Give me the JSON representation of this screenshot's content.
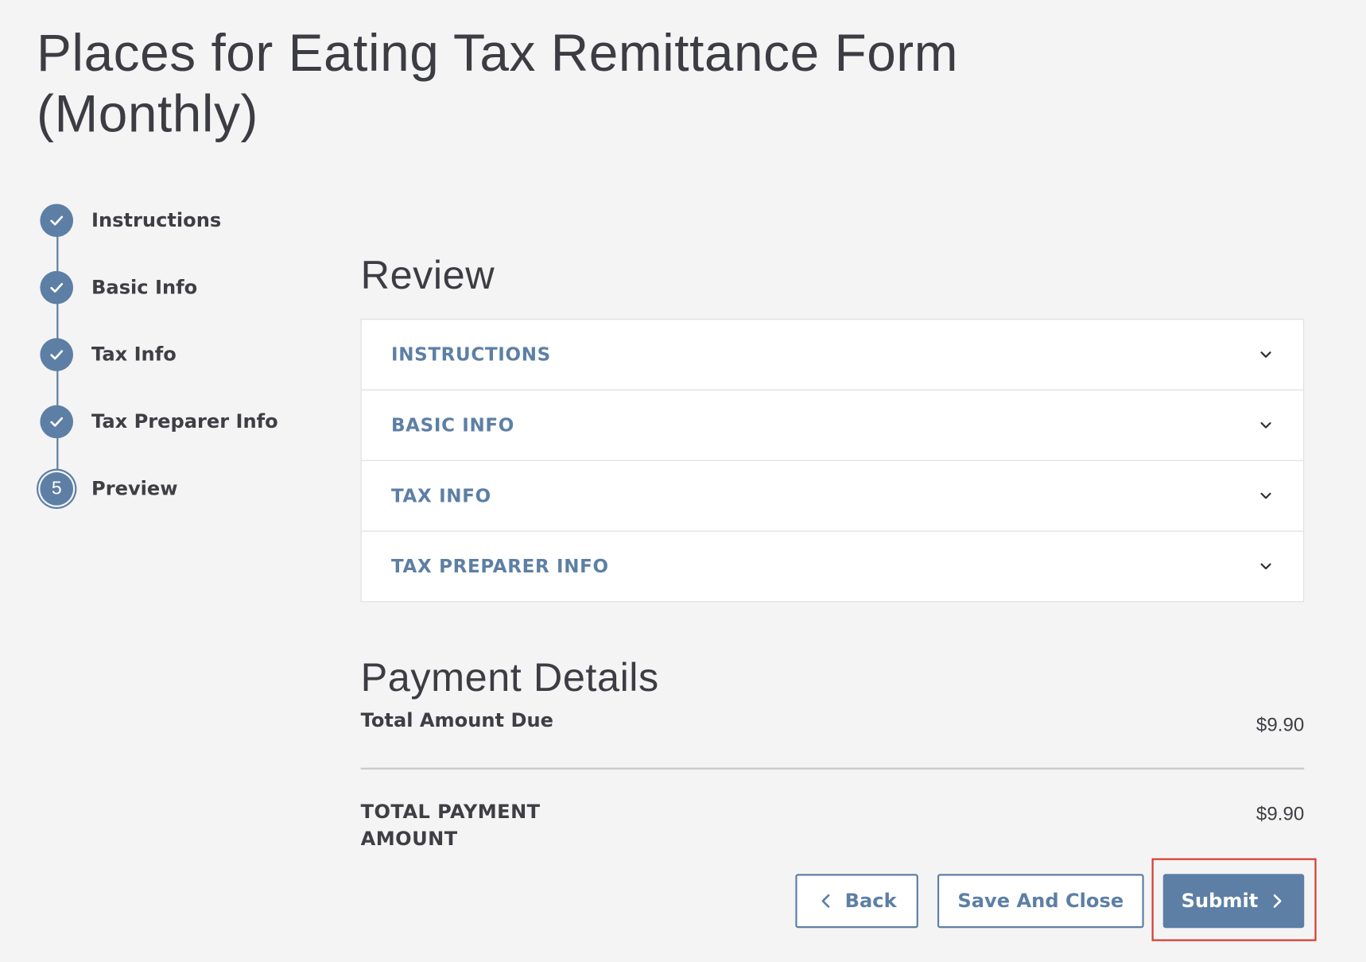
{
  "page": {
    "title": "Places for Eating Tax Remittance Form (Monthly)"
  },
  "stepper": {
    "steps": [
      {
        "label": "Instructions",
        "status": "completed",
        "icon": "check-icon"
      },
      {
        "label": "Basic Info",
        "status": "completed",
        "icon": "check-icon"
      },
      {
        "label": "Tax Info",
        "status": "completed",
        "icon": "check-icon"
      },
      {
        "label": "Tax Preparer Info",
        "status": "completed",
        "icon": "check-icon"
      },
      {
        "label": "Preview",
        "status": "current",
        "number": "5"
      }
    ]
  },
  "review": {
    "heading": "Review",
    "sections": [
      {
        "label": "INSTRUCTIONS",
        "icon": "chevron-down-icon"
      },
      {
        "label": "BASIC INFO",
        "icon": "chevron-down-icon"
      },
      {
        "label": "TAX INFO",
        "icon": "chevron-down-icon"
      },
      {
        "label": "TAX PREPARER INFO",
        "icon": "chevron-down-icon"
      }
    ]
  },
  "payment": {
    "heading": "Payment Details",
    "total_due_label": "Total Amount Due",
    "total_due_value": "$9.90",
    "total_payment_label": "TOTAL PAYMENT AMOUNT",
    "total_payment_value": "$9.90"
  },
  "actions": {
    "back_label": "Back",
    "save_close_label": "Save And Close",
    "submit_label": "Submit"
  },
  "colors": {
    "accent": "#5d7fa5",
    "background": "#f4f4f4",
    "highlight": "#d63b2f"
  }
}
